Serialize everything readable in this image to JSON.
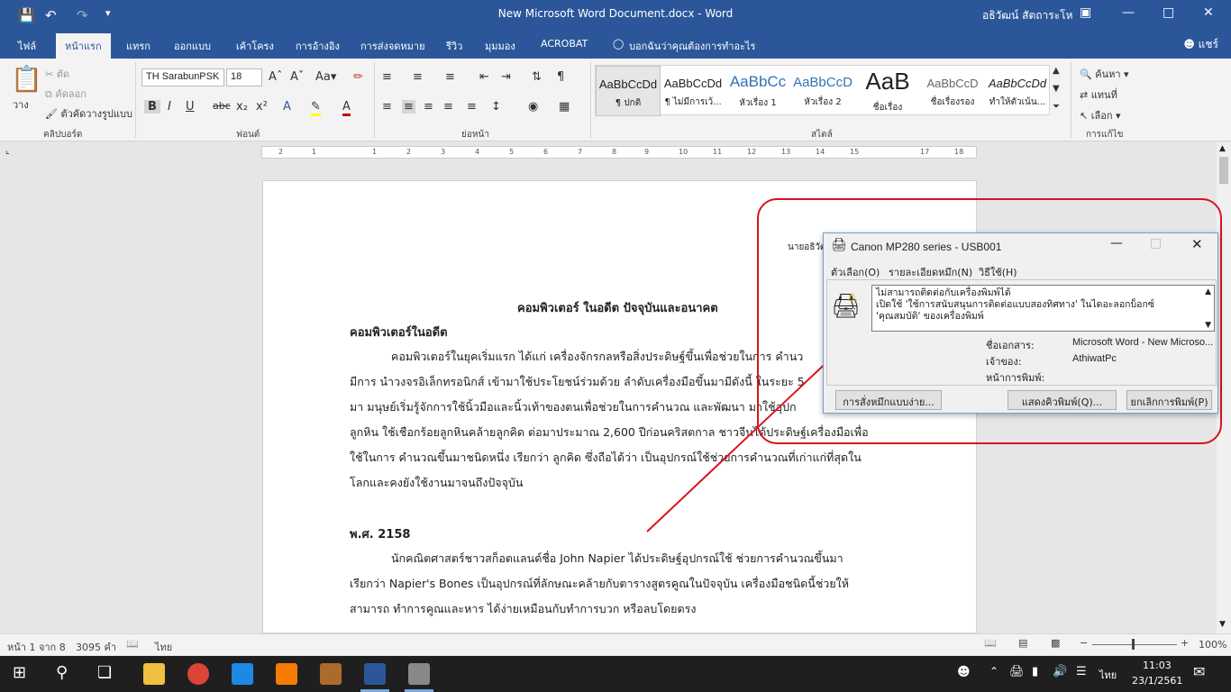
{
  "titlebar": {
    "title": "New Microsoft Word Document.docx  -  Word",
    "user": "อธิวัฒน์ สัตถาระโห"
  },
  "tabs": [
    "ไฟล์",
    "หน้าแรก",
    "แทรก",
    "ออกแบบ",
    "เค้าโครง",
    "การอ้างอิง",
    "การส่งจดหมาย",
    "รีวิว",
    "มุมมอง",
    "ACROBAT"
  ],
  "tell_me": "บอกฉันว่าคุณต้องการทำอะไร",
  "share": "แชร์",
  "clipboard": {
    "paste": "วาง",
    "cut": "ตัด",
    "copy": "คัดลอก",
    "format_painter": "ตัวคัดวางรูปแบบ",
    "label": "คลิปบอร์ด"
  },
  "font": {
    "name": "TH SarabunPSK",
    "size": "18",
    "label": "ฟอนต์"
  },
  "paragraph": {
    "label": "ย่อหน้า"
  },
  "styles": {
    "label": "สไตล์",
    "items": [
      {
        "preview": "AaBbCcDd",
        "name": "¶ ปกติ"
      },
      {
        "preview": "AaBbCcDd",
        "name": "¶ ไม่มีการเว้..."
      },
      {
        "preview": "AaBbCc",
        "name": "หัวเรื่อง 1"
      },
      {
        "preview": "AaBbCcD",
        "name": "หัวเรื่อง 2"
      },
      {
        "preview": "AaB",
        "name": "ชื่อเรื่อง"
      },
      {
        "preview": "AaBbCcD",
        "name": "ชื่อเรื่องรอง"
      },
      {
        "preview": "AaBbCcDd",
        "name": "ทำให้ตัวเน้น..."
      }
    ]
  },
  "editing": {
    "find": "ค้นหา",
    "replace": "แทนที่",
    "select": "เลือก",
    "label": "การแก้ไข"
  },
  "ruler_marks": [
    "2",
    "1",
    "1",
    "2",
    "3",
    "4",
    "5",
    "6",
    "7",
    "8",
    "9",
    "10",
    "11",
    "12",
    "13",
    "14",
    "15",
    "17",
    "18"
  ],
  "document": {
    "author": "นายอธิวัฒ",
    "title": "คอมพิวเตอร์ ในอดีต ปัจจุบันและอนาคต",
    "heading1": "คอมพิวเตอร์ในอดีต",
    "p1": [
      "คอมพิวเตอร์ในยุคเริ่มแรก ได้แก่ เครื่องจักรกลหรือสิ่งประดิษฐ์ขึ้นเพื่อช่วยในการ คำนว",
      "มีการ นำวงจรอิเล็กทรอนิกส์ เข้ามาใช้ประโยชน์ร่วมด้วย ลำดับเครื่องมือขึ้นมามีดังนี้ ในระยะ 5",
      "มา มนุษย์เริ่มรู้จักการใช้นิ้วมือและนิ้วเท้าของตนเพื่อช่วยในการคำนวณ และพัฒนา มาใช้อุปก",
      "ลูกหิน ใช้เชือกร้อยลูกหินคล้ายลูกคิด ต่อมาประมาณ 2,600 ปีก่อนคริสตกาล ชาวจีนได้ประดิษฐ์เครื่องมือเพื่อ",
      "ใช้ในการ คำนวณขึ้นมาชนิดหนึ่ง เรียกว่า ลูกคิด ซึ่งถือได้ว่า เป็นอุปกรณ์ใช้ช่วยการคำนวณที่เก่าแก่ที่สุดใน",
      "โลกและคงยังใช้งานมาจนถึงปัจจุบัน"
    ],
    "heading2": "พ.ศ. 2158",
    "p2": [
      "นักคณิตศาสตร์ชาวสก็อตแลนด์ชื่อ John Napier ได้ประดิษฐ์อุปกรณ์ใช้ ช่วยการคำนวณขึ้นมา",
      "เรียกว่า Napier's Bones เป็นอุปกรณ์ที่ลักษณะคล้ายกับตารางสูตรคูณในปัจจุบัน เครื่องมือชนิดนี้ช่วยให้",
      "สามารถ ทำการคูณและหาร ได้ง่ายเหมือนกับทำการบวก หรือลบโดยตรง"
    ]
  },
  "dialog": {
    "title": "Canon MP280 series - USB001",
    "menu": [
      "ตัวเลือก(O)",
      "รายละเอียดหมึก(N)",
      "วิธีใช้(H)"
    ],
    "message": [
      "ไม่สามารถติดต่อกับเครื่องพิมพ์ได้",
      "เปิดใช้ 'ใช้การสนับสนุนการติดต่อแบบสองทิศทาง' ในไดอะลอกบ็อกซ์",
      "'คุณสมบัติ' ของเครื่องพิมพ์"
    ],
    "doc_label": "ชื่อเอกสาร:",
    "doc_value": "Microsoft Word - New Microso...",
    "owner_label": "เจ้าของ:",
    "owner_value": "AthiwatPc",
    "page_label": "หน้าการพิมพ์:",
    "btn_ink": "การสั่งหมึกแบบง่าย...",
    "btn_queue": "แสดงคิวพิมพ์(Q)...",
    "btn_cancel": "ยกเลิกการพิมพ์(P)"
  },
  "status": {
    "page": "หน้า 1 จาก 8",
    "words": "3095 คำ",
    "lang": "ไทย",
    "zoom": "100%"
  },
  "taskbar": {
    "lang": "ไทย",
    "time": "11:03",
    "date": "23/1/2561"
  },
  "colors": {
    "accent": "#2b579a",
    "highlight": "#d9121f"
  }
}
